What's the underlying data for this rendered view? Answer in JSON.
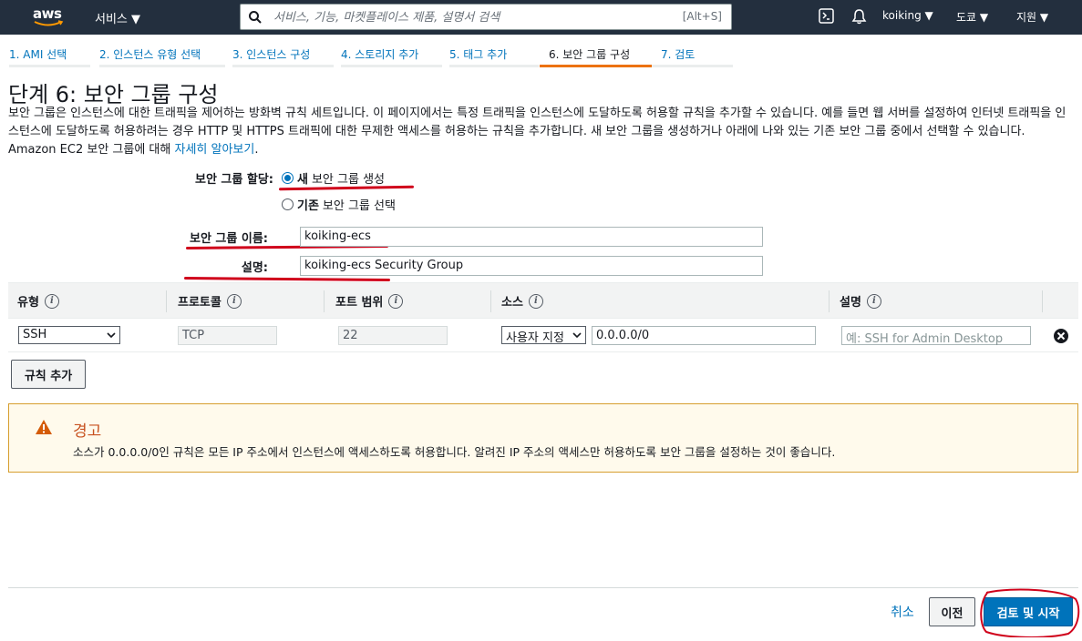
{
  "topnav": {
    "logo_text": "aws",
    "services_label": "서비스 ▼",
    "search_placeholder": "서비스, 기능, 마켓플레이스 제품, 설명서 검색",
    "search_shortcut": "[Alt+S]",
    "user_label": "koiking ▼",
    "region_label": "도쿄 ▼",
    "support_label": "지원 ▼"
  },
  "wizard": {
    "tabs": [
      {
        "label": "1. AMI 선택"
      },
      {
        "label": "2. 인스턴스 유형 선택"
      },
      {
        "label": "3. 인스턴스 구성"
      },
      {
        "label": "4. 스토리지 추가"
      },
      {
        "label": "5. 태그 추가"
      },
      {
        "label": "6. 보안 그룹 구성"
      },
      {
        "label": "7. 검토"
      }
    ],
    "active_index": 5
  },
  "page": {
    "title": "단계 6: 보안 그룹 구성",
    "description": "보안 그룹은 인스턴스에 대한 트래픽을 제어하는 방화벽 규칙 세트입니다. 이 페이지에서는 특정 트래픽을 인스턴스에 도달하도록 허용할 규칙을 추가할 수 있습니다. 예를 들면 웹 서버를 설정하여 인터넷 트래픽을 인스턴스에 도달하도록 허용하려는 경우 HTTP 및 HTTPS 트래픽에 대한 무제한 액세스를 허용하는 규칙을 추가합니다. 새 보안 그룹을 생성하거나 아래에 나와 있는 기존 보안 그룹 중에서 선택할 수 있습니다. Amazon EC2 보안 그룹에 대해 ",
    "learn_more": "자세히 알아보기",
    "desc_end": "."
  },
  "form": {
    "assign_label": "보안 그룹 할당:",
    "option_new_bold": "새",
    "option_new_rest": " 보안 그룹 생성",
    "option_existing_bold": "기존",
    "option_existing_rest": " 보안 그룹 선택",
    "name_label": "보안 그룹 이름:",
    "name_value": "koiking-ecs",
    "desc_label": "설명:",
    "desc_value": "koiking-ecs Security Group"
  },
  "rules": {
    "headers": {
      "type": "유형",
      "protocol": "프로토콜",
      "port": "포트 범위",
      "source": "소스",
      "description": "설명"
    },
    "row": {
      "type": "SSH",
      "protocol": "TCP",
      "port": "22",
      "source_mode": "사용자 지정",
      "source_cidr": "0.0.0.0/0",
      "description_placeholder": "예: SSH for Admin Desktop"
    },
    "add_rule": "규칙 추가"
  },
  "warning": {
    "title": "경고",
    "text": "소스가 0.0.0.0/0인 규칙은 모든 IP 주소에서 인스턴스에 액세스하도록 허용합니다. 알려진 IP 주소의 액세스만 허용하도록 보안 그룹을 설정하는 것이 좋습니다."
  },
  "footer": {
    "cancel": "취소",
    "previous": "이전",
    "launch": "검토 및 시작"
  },
  "colors": {
    "nav_bg": "#232f3e",
    "accent": "#ec7211",
    "link": "#0073bb",
    "annotation_red": "#d0021b"
  }
}
